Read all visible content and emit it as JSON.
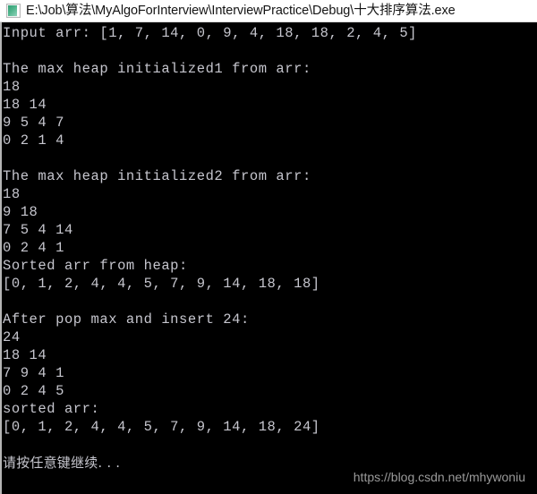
{
  "window": {
    "title": "E:\\Job\\算法\\MyAlgoForInterview\\InterviewPractice\\Debug\\十大排序算法.exe",
    "icon": "console-app-icon",
    "titlebar_background": "#ffffff",
    "titlebar_text_color": "#141414",
    "console_background": "#000000",
    "console_text_color": "#c6c6ce"
  },
  "console": {
    "lines": [
      "Input arr: [1, 7, 14, 0, 9, 4, 18, 18, 2, 4, 5]",
      "",
      "The max heap initialized1 from arr:",
      "18",
      "18 14",
      "9 5 4 7",
      "0 2 1 4",
      "",
      "The max heap initialized2 from arr:",
      "18",
      "9 18",
      "7 5 4 14",
      "0 2 4 1",
      "Sorted arr from heap:",
      "[0, 1, 2, 4, 4, 5, 7, 9, 14, 18, 18]",
      "",
      "After pop max and insert 24:",
      "24",
      "18 14",
      "7 9 4 1",
      "0 2 4 5",
      "sorted arr:",
      "[0, 1, 2, 4, 4, 5, 7, 9, 14, 18, 24]",
      ""
    ],
    "prompt": "请按任意键继续. . ."
  },
  "watermark": {
    "text": "https://blog.csdn.net/mhywoniu",
    "color": "#9a9a9a"
  }
}
